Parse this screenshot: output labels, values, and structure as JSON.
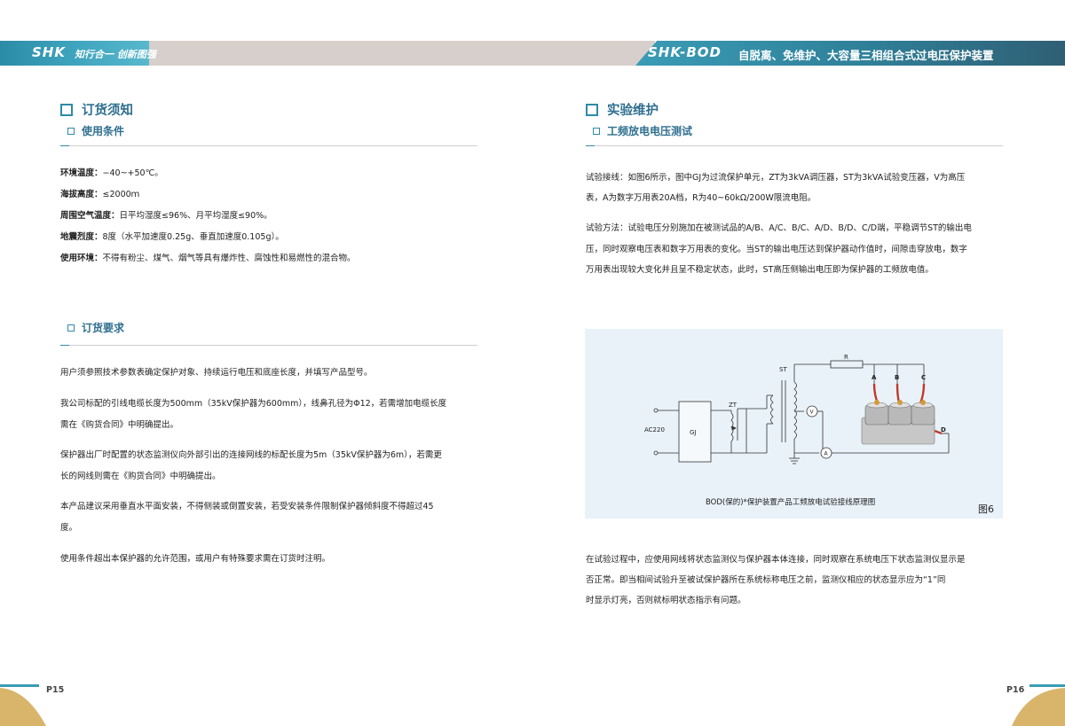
{
  "header": {
    "brand": "SHK",
    "slogan": "知行合一 创新图强",
    "model": "SHK-BOD",
    "title": "自脱离、免维护、大容量三相组合式过电压保护装置"
  },
  "left": {
    "section_title": "订货须知",
    "sub1_title": "使用条件",
    "conditions": [
      {
        "label": "环境温度：",
        "value": "−40~+50℃。"
      },
      {
        "label": "海拔高度：",
        "value": "≤2000ｍ"
      },
      {
        "label": "周围空气温度：",
        "value": "日平均湿度≤96%、月平均湿度≤90%。"
      },
      {
        "label": "地震烈度：",
        "value": "8度（水平加速度0.25g、垂直加速度0.105g）。"
      },
      {
        "label": "使用环境：",
        "value": "不得有粉尘、煤气、烟气等具有爆炸性、腐蚀性和易燃性的混合物。"
      }
    ],
    "sub2_title": "订货要求",
    "order_lines": [
      "用户须参照技术参数表确定保护对象、持续运行电压和底座长度，并填写产品型号。",
      "我公司标配的引线电缆长度为500mm（35kV保护器为600mm），线鼻孔径为Φ12，若需增加电缆长度",
      "需在《购货合同》中明确提出。",
      "保护器出厂时配置的状态监测仪向外部引出的连接网线的标配长度为5m（35kV保护器为6m），若需更",
      "长的网线则需在《购货合同》中明确提出。",
      "本产品建议采用垂直水平面安装，不得侧装或倒置安装，若受安装条件限制保护器倾斜度不得超过45",
      "度。",
      "使用条件超出本保护器的允许范围，或用户有特殊要求需在订货时注明。"
    ],
    "page_number": "P15"
  },
  "right": {
    "section_title": "实验维护",
    "sub1_title": "工频放电电压测试",
    "wiring_lines": [
      "试验接线：如图6所示，图中GJ为过流保护单元，ZT为3kVA调压器，ST为3kVA试验变压器，V为高压",
      "表，A为数字万用表20A档，R为40~60kΩ/200W限流电阻。"
    ],
    "method_lines": [
      "试验方法：试验电压分别施加在被测试品的A/B、A/C、B/C、A/D、B/D、C/D端，平稳调节ST的输出电",
      "压，同时观察电压表和数字万用表的变化。当ST的输出电压达到保护器动作值时，间隙击穿放电，数字",
      "万用表出现较大变化并且呈不稳定状态，此时，ST高压侧输出电压即为保护器的工频放电值。"
    ],
    "figure": {
      "labels": {
        "ac": "AC220",
        "gj": "GJ",
        "zt": "ZT",
        "st": "ST",
        "r": "R",
        "v": "V",
        "a_meter": "A",
        "a": "A",
        "b": "B",
        "c": "C",
        "d": "D"
      },
      "caption": "BOD(保的)*保护装置产品工频放电试验接线原理图",
      "label": "图6"
    },
    "process_lines": [
      "在试验过程中，应使用网线将状态监测仪与保护器本体连接，同时观察在系统电压下状态监测仪显示是",
      "否正常。即当相间试验升至被试保护器所在系统标称电压之前，监测仪相应的状态显示应为“1”同",
      "时显示灯亮，否则就标明状态指示有问题。"
    ],
    "page_number": "P16"
  }
}
